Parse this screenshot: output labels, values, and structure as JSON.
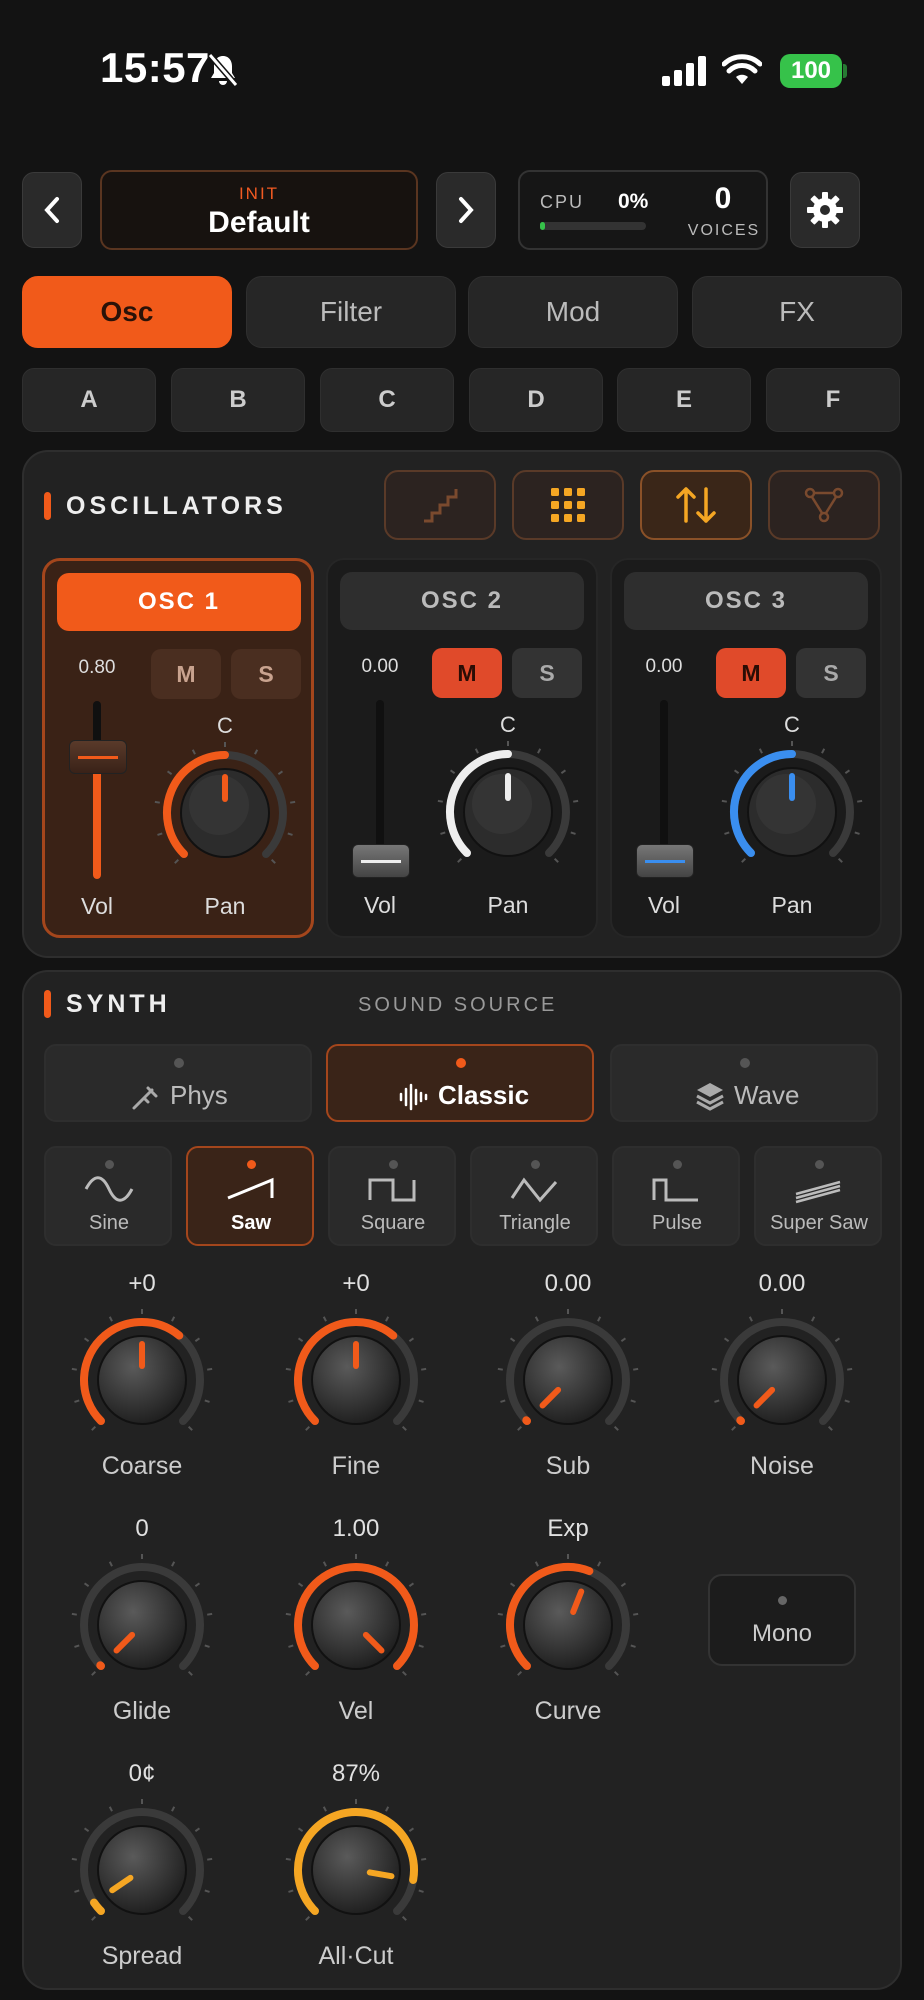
{
  "status_bar": {
    "time": "15:57",
    "battery": "100"
  },
  "header": {
    "preset_category": "INIT",
    "preset_name": "Default",
    "cpu_label": "CPU",
    "cpu_value": "0%",
    "voices_value": "0",
    "voices_label": "VOICES"
  },
  "tabs": [
    {
      "label": "Osc",
      "active": true
    },
    {
      "label": "Filter",
      "active": false
    },
    {
      "label": "Mod",
      "active": false
    },
    {
      "label": "FX",
      "active": false
    }
  ],
  "slots": [
    "A",
    "B",
    "C",
    "D",
    "E",
    "F"
  ],
  "oscillators": {
    "title": "OSCILLATORS",
    "tools": [
      "staircase-icon",
      "grid-icon",
      "up-down-arrows-icon",
      "routing-icon"
    ],
    "cards": [
      {
        "name": "OSC 1",
        "volume": "0.80",
        "mute": "M",
        "solo": "S",
        "pan_label": "C",
        "vol_label": "Vol",
        "pan_caption": "Pan",
        "muted": false,
        "vol_level": 0.8,
        "pan_color": "#f15a1a"
      },
      {
        "name": "OSC 2",
        "volume": "0.00",
        "mute": "M",
        "solo": "S",
        "pan_label": "C",
        "vol_label": "Vol",
        "pan_caption": "Pan",
        "muted": true,
        "vol_level": 0.0,
        "pan_color": "#eeeeee"
      },
      {
        "name": "OSC 3",
        "volume": "0.00",
        "mute": "M",
        "solo": "S",
        "pan_label": "C",
        "vol_label": "Vol",
        "pan_caption": "Pan",
        "muted": true,
        "vol_level": 0.0,
        "pan_color": "#3a8eef"
      }
    ]
  },
  "synth": {
    "title": "SYNTH",
    "source_label": "SOUND SOURCE",
    "sources": [
      {
        "label": "Phys",
        "icon": "tuning-fork-icon",
        "active": false
      },
      {
        "label": "Classic",
        "icon": "waveform-icon",
        "active": true
      },
      {
        "label": "Wave",
        "icon": "layers-icon",
        "active": false
      }
    ],
    "waves": [
      {
        "label": "Sine",
        "icon": "sine-wave-icon",
        "active": false
      },
      {
        "label": "Saw",
        "icon": "saw-wave-icon",
        "active": true
      },
      {
        "label": "Square",
        "icon": "square-wave-icon",
        "active": false
      },
      {
        "label": "Triangle",
        "icon": "triangle-wave-icon",
        "active": false
      },
      {
        "label": "Pulse",
        "icon": "pulse-wave-icon",
        "active": false
      },
      {
        "label": "Super Saw",
        "icon": "super-saw-icon",
        "active": false
      }
    ],
    "knobs": [
      {
        "value": "+0",
        "label": "Coarse",
        "level": 0.5,
        "color": "#f15a1a"
      },
      {
        "value": "+0",
        "label": "Fine",
        "level": 0.5,
        "color": "#f15a1a"
      },
      {
        "value": "0.00",
        "label": "Sub",
        "level": 0.0,
        "color": "#f15a1a"
      },
      {
        "value": "0.00",
        "label": "Noise",
        "level": 0.0,
        "color": "#f15a1a"
      },
      {
        "value": "0",
        "label": "Glide",
        "level": 0.0,
        "color": "#f15a1a"
      },
      {
        "value": "1.00",
        "label": "Vel",
        "level": 1.0,
        "color": "#f15a1a"
      },
      {
        "value": "Exp",
        "label": "Curve",
        "level": 0.58,
        "color": "#f15a1a"
      },
      {
        "value": "0¢",
        "label": "Spread",
        "level": 0.04,
        "color": "#f5a623"
      },
      {
        "value": "87%",
        "label": "All·Cut",
        "level": 0.87,
        "color": "#f5a623"
      }
    ],
    "mono_label": "Mono"
  },
  "colors": {
    "accent": "#f15a1a",
    "amber": "#f5a623",
    "blue": "#3a8eef",
    "mute_red": "#e04a2a"
  }
}
